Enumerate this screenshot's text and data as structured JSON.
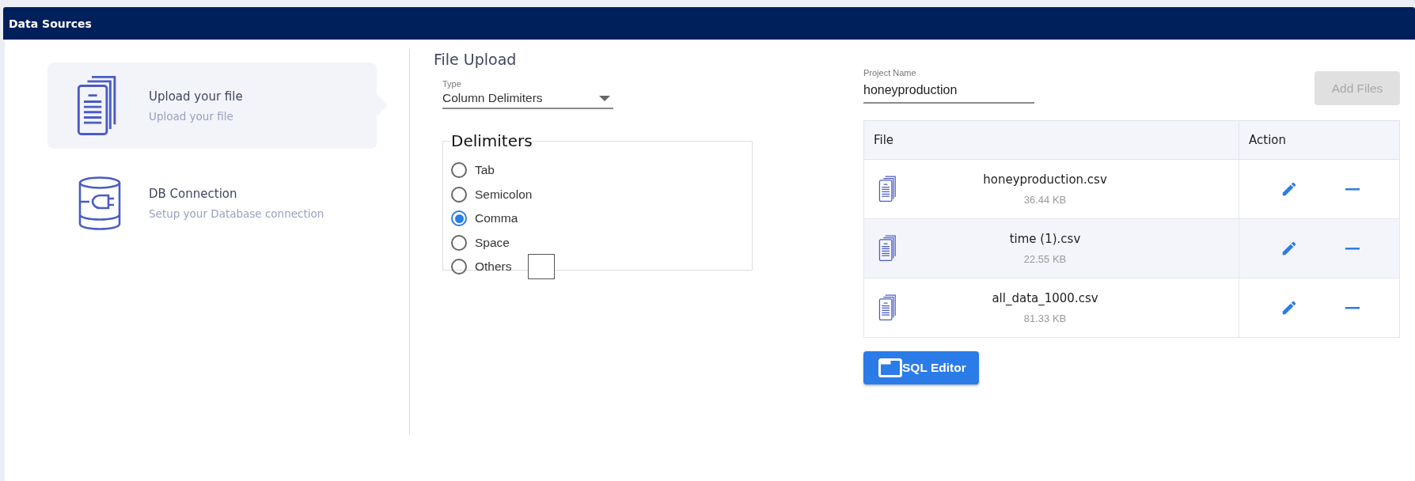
{
  "header": {
    "title": "Data Sources"
  },
  "sidebar": {
    "items": [
      {
        "kind": "file",
        "title": "Upload your file",
        "subtitle": "Upload your file",
        "selected": true
      },
      {
        "kind": "database",
        "title": "DB Connection",
        "subtitle": "Setup your Database connection",
        "selected": false
      }
    ]
  },
  "upload": {
    "title": "File Upload",
    "type_select": {
      "label": "Type",
      "value": "Column Delimiters"
    },
    "delimiters": {
      "legend": "Delimiters",
      "options": [
        {
          "kind": "plain",
          "label": "Tab",
          "selected": false
        },
        {
          "kind": "plain",
          "label": "Semicolon",
          "selected": false
        },
        {
          "kind": "plain",
          "label": "Comma",
          "selected": true
        },
        {
          "kind": "plain",
          "label": "Space",
          "selected": false
        },
        {
          "kind": "custom",
          "label": "Others",
          "selected": false
        }
      ]
    },
    "project_name": {
      "label": "Project Name",
      "value": "honeyproduction"
    },
    "add_files_button": {
      "label": "Add Files",
      "disabled": true
    },
    "table": {
      "columns": [
        "File",
        "Action"
      ],
      "rows": [
        {
          "name": "honeyproduction.csv",
          "size": "36.44 KB"
        },
        {
          "name": "time (1).csv",
          "size": "22.55 KB"
        },
        {
          "name": "all_data_1000.csv",
          "size": "81.33 KB"
        }
      ]
    },
    "sql_editor_button": {
      "label": "SQL Editor"
    }
  }
}
